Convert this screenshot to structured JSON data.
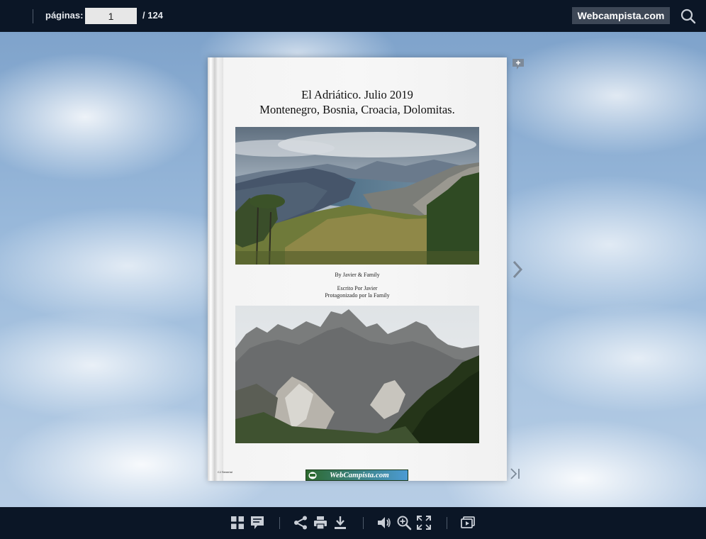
{
  "topbar": {
    "pages_label": "páginas:",
    "current_page": "1",
    "total_pages": "/ 124",
    "brand_label": "Webcampista.com",
    "search_icon": "search-icon"
  },
  "document": {
    "title_line1": "El Adriático. Julio 2019",
    "title_line2": "Montenegro, Bosnia, Croacia, Dolomitas.",
    "by_line": "By Javier & Family",
    "written_by": "Escrito Por Javier",
    "starring": "Protagonizado por la Family",
    "footnote": "CJ Senerial",
    "logo_text": "WebCampista.com"
  },
  "side_controls": {
    "add_comment_icon": "comment-plus-icon",
    "next_icon": "chevron-right-icon",
    "last_icon": "skip-to-end-icon"
  },
  "toolbar": {
    "icons": [
      "thumbnails-icon",
      "notes-icon",
      "share-icon",
      "print-icon",
      "download-icon",
      "sound-icon",
      "zoom-in-icon",
      "fullscreen-icon",
      "slideshow-icon"
    ]
  },
  "colors": {
    "bar_background": "#0b1626",
    "icon_color": "#c9ced6",
    "brand_button": "#3d4756"
  }
}
